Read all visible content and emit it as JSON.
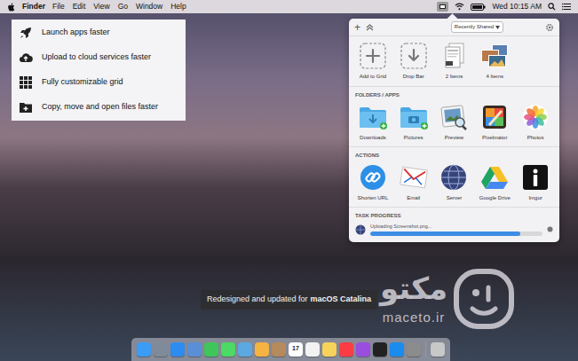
{
  "menu_bar": {
    "app": "Finder",
    "menus": [
      "File",
      "Edit",
      "View",
      "Go",
      "Window",
      "Help"
    ],
    "clock": "Wed 10:15 AM"
  },
  "features": [
    {
      "label": "Launch apps faster"
    },
    {
      "label": "Upload to cloud services faster"
    },
    {
      "label": "Fully customizable grid"
    },
    {
      "label": "Copy, move and open files faster"
    }
  ],
  "popover": {
    "toolbar": {
      "add": "+",
      "dropdown": "Recently Shared"
    },
    "top_items": [
      {
        "label": "Add to Grid"
      },
      {
        "label": "Drop Bar"
      },
      {
        "label": "2 Items"
      },
      {
        "label": "4 Items"
      }
    ],
    "sections": [
      {
        "title": "FOLDERS / APPS",
        "items": [
          {
            "label": "Downloads"
          },
          {
            "label": "Pictures"
          },
          {
            "label": "Preview"
          },
          {
            "label": "Pixelmator"
          },
          {
            "label": "Photos"
          }
        ]
      },
      {
        "title": "ACTIONS",
        "items": [
          {
            "label": "Shorten URL"
          },
          {
            "label": "Email"
          },
          {
            "label": "Server"
          },
          {
            "label": "Google Drive"
          },
          {
            "label": "Imgur"
          }
        ]
      }
    ],
    "task_progress": {
      "title": "TASK PROGRESS",
      "label": "Uploading Screenshot.png...",
      "level": 0.87
    }
  },
  "caption": {
    "text": "Redesigned and updated for",
    "emphasis": "macOS Catalina"
  },
  "watermark": {
    "name": "مکتو",
    "site": "maceto.ir"
  },
  "dock": {
    "items": [
      {
        "color": "#3b9cf5",
        "label": ""
      },
      {
        "color": "#7f8b99",
        "label": ""
      },
      {
        "color": "#2d8cf0",
        "label": ""
      },
      {
        "color": "#5a8fd6",
        "label": ""
      },
      {
        "color": "#3fc65a",
        "label": ""
      },
      {
        "color": "#4cd964",
        "label": ""
      },
      {
        "color": "#5ca8e0",
        "label": ""
      },
      {
        "color": "#f5b342",
        "label": ""
      },
      {
        "color": "#b58a5c",
        "label": ""
      },
      {
        "color": "#ffffff",
        "label": "17"
      },
      {
        "color": "#f2f2f2",
        "label": ""
      },
      {
        "color": "#f7d35a",
        "label": ""
      },
      {
        "color": "#fc3c44",
        "label": ""
      },
      {
        "color": "#9b4de0",
        "label": ""
      },
      {
        "color": "#222222",
        "label": ""
      },
      {
        "color": "#1a8cf0",
        "label": ""
      },
      {
        "color": "#8c8c8c",
        "label": ""
      },
      {
        "color": "#c8c8c8",
        "label": ""
      }
    ]
  }
}
